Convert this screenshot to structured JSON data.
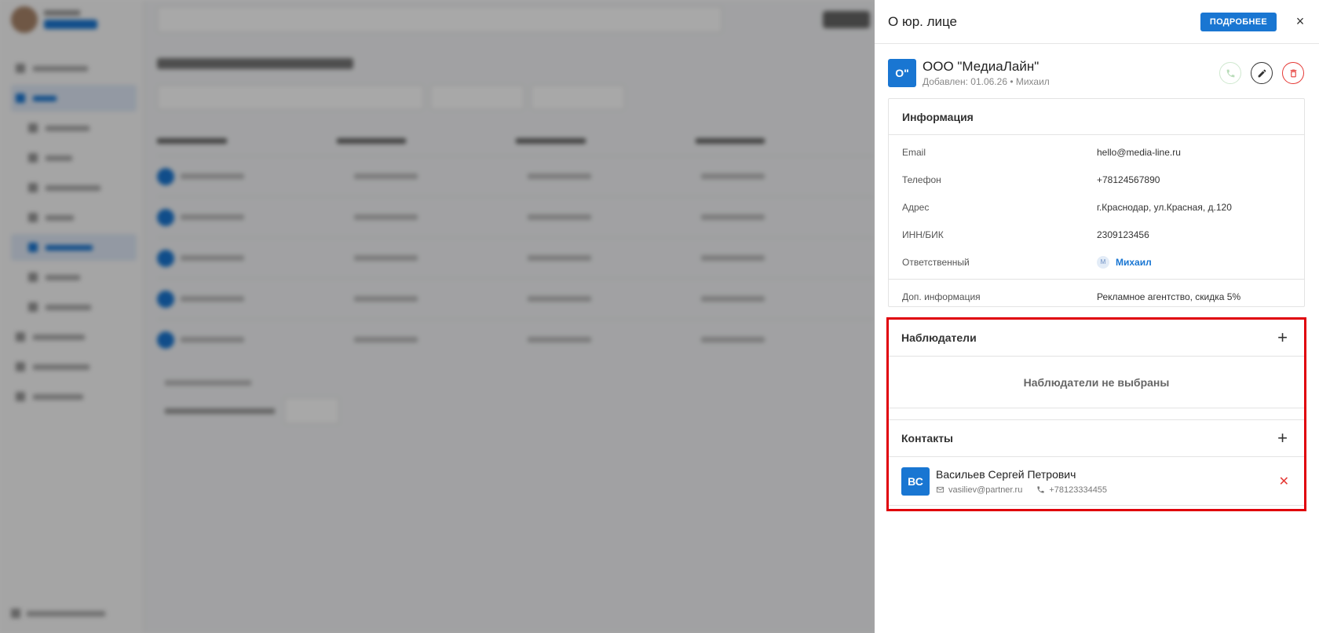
{
  "drawer": {
    "title": "О юр. лице",
    "more_label": "ПОДРОБНЕЕ",
    "close_icon": "×"
  },
  "entity": {
    "logo": "О\"",
    "name": "ООО \"МедиаЛайн\"",
    "meta": "Добавлен: 01.06.26 • Михаил"
  },
  "info": {
    "title": "Информация",
    "rows": [
      {
        "key": "Email",
        "value": "hello@media-line.ru"
      },
      {
        "key": "Телефон",
        "value": "+78124567890"
      },
      {
        "key": "Адрес",
        "value": "г.Краснодар, ул.Красная, д.120"
      },
      {
        "key": "ИНН/БИК",
        "value": "2309123456"
      },
      {
        "key": "Ответственный",
        "value": "Михаил",
        "avatar": "М"
      }
    ],
    "extra": {
      "key": "Доп. информация",
      "value": "Рекламное агентство, скидка 5%"
    }
  },
  "observers": {
    "title": "Наблюдатели",
    "empty": "Наблюдатели не выбраны"
  },
  "contacts": {
    "title": "Контакты",
    "items": [
      {
        "initials": "ВС",
        "name": "Васильев Сергей Петрович",
        "email": "vasiliev@partner.ru",
        "phone": "+78123334455"
      }
    ]
  },
  "colors": {
    "accent": "#1976d2",
    "danger": "#e53935",
    "highlight": "#e0000b"
  }
}
